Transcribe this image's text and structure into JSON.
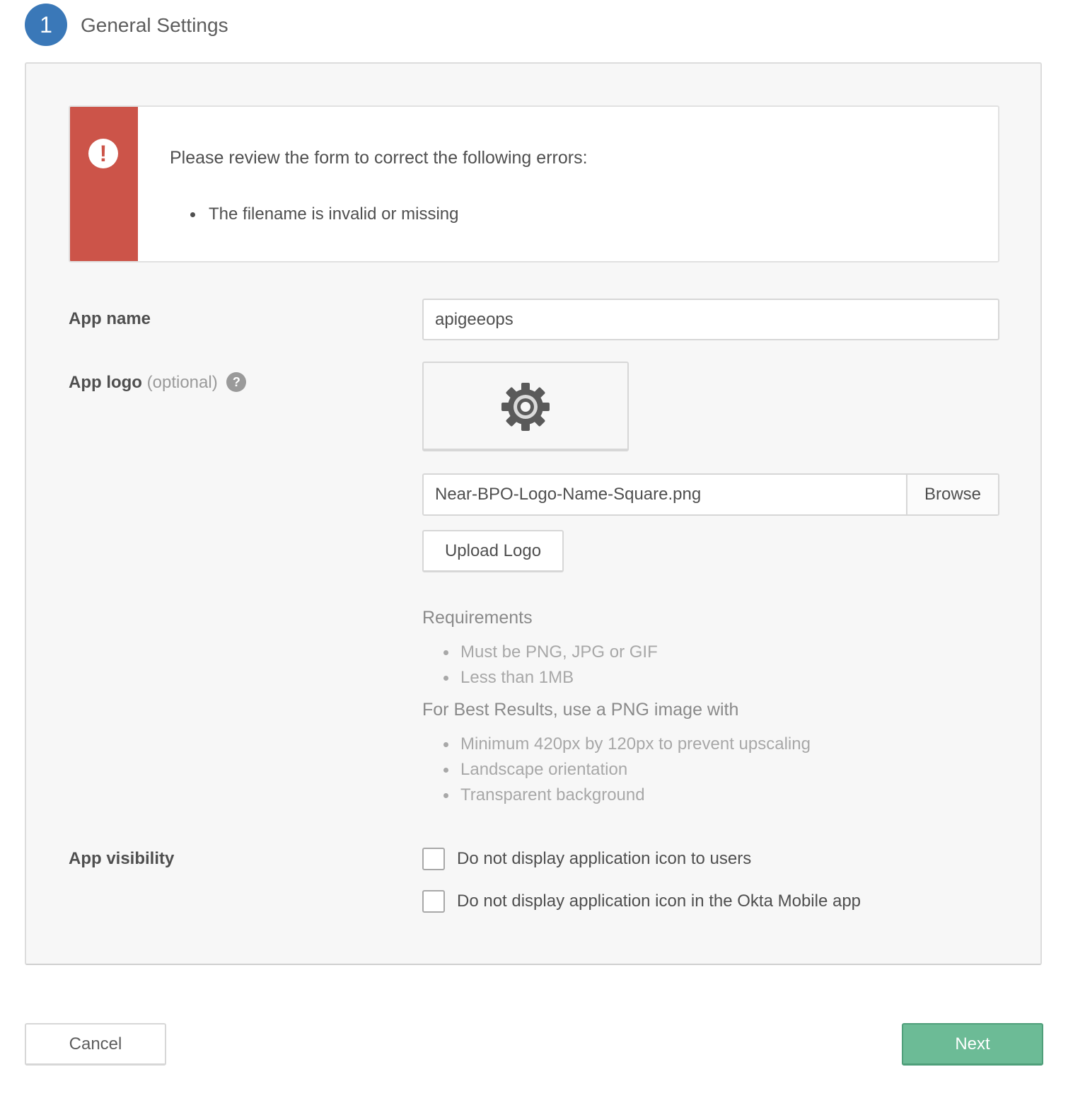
{
  "step": {
    "number": "1",
    "title": "General Settings"
  },
  "colors": {
    "step_circle": "#3a78b8",
    "error_stripe": "#cc5449",
    "next_button": "#6cbb96"
  },
  "error": {
    "icon": "exclamation-circle-icon",
    "title": "Please review the form to correct the following errors:",
    "items": [
      "The filename is invalid or missing"
    ]
  },
  "app_name": {
    "label": "App name",
    "value": "apigeeops"
  },
  "app_logo": {
    "label": "App logo",
    "optional": "(optional)",
    "help_icon": "?",
    "preview_icon": "gear-icon",
    "file_name": "Near-BPO-Logo-Name-Square.png",
    "browse_label": "Browse",
    "upload_label": "Upload Logo",
    "requirements_heading": "Requirements",
    "requirements": [
      "Must be PNG, JPG or GIF",
      "Less than 1MB"
    ],
    "best_results_heading": "For Best Results, use a PNG image with",
    "best_results": [
      "Minimum 420px by 120px to prevent upscaling",
      "Landscape orientation",
      "Transparent background"
    ]
  },
  "app_visibility": {
    "label": "App visibility",
    "options": [
      {
        "label": "Do not display application icon to users",
        "checked": false
      },
      {
        "label": "Do not display application icon in the Okta Mobile app",
        "checked": false
      }
    ]
  },
  "footer": {
    "cancel_label": "Cancel",
    "next_label": "Next"
  }
}
